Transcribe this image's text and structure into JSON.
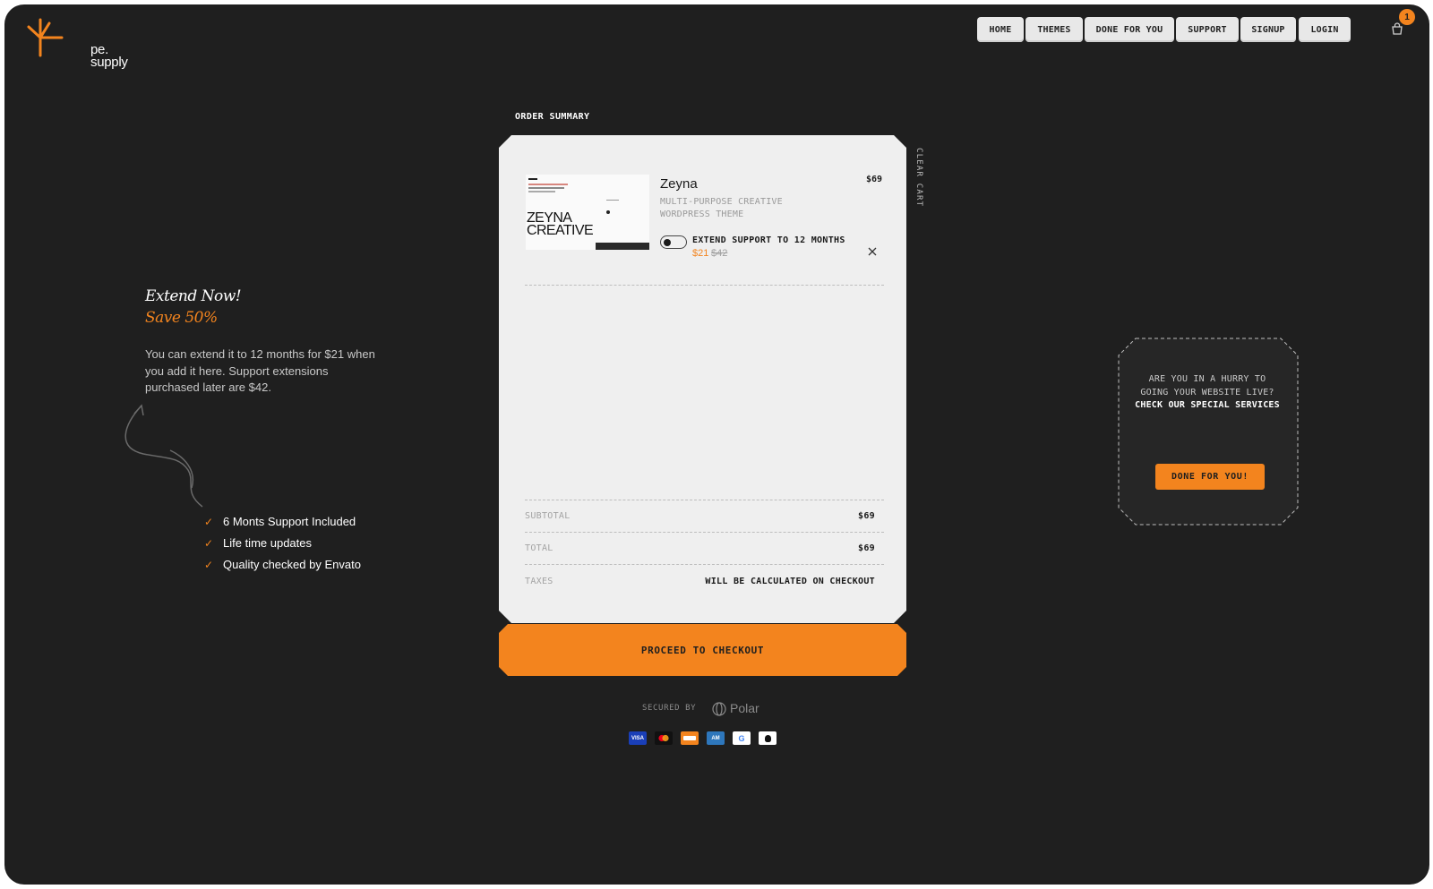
{
  "brand": {
    "logo_line1": "pe.",
    "logo_line2": "supply",
    "accent_color": "#f3841e"
  },
  "nav": {
    "items": [
      "HOME",
      "THEMES",
      "DONE FOR YOU",
      "SUPPORT",
      "SIGNUP",
      "LOGIN"
    ],
    "cart_count": "1",
    "cart_icon": "shopping-bag-icon"
  },
  "promo": {
    "title": "Extend Now!",
    "subtitle": "Save 50%",
    "text": "You can extend it to 12 months for $21 when you add it here. Support extensions purchased later are $42.",
    "features": [
      "6 Monts Support Included",
      "Life time updates",
      "Quality checked by Envato"
    ]
  },
  "order": {
    "label": "ORDER SUMMARY",
    "clear_cart": "CLEAR CART",
    "item": {
      "thumb_title_1": "ZEYNA",
      "thumb_title_2": "CREATIVE",
      "name": "Zeyna",
      "price": "$69",
      "description": "MULTI-PURPOSE CREATIVE WORDPRESS THEME",
      "extend_label": "EXTEND SUPPORT TO 12 MONTHS",
      "extend_price": "$21",
      "extend_old_price": "$42"
    },
    "subtotal_label": "SUBTOTAL",
    "subtotal_value": "$69",
    "total_label": "TOTAL",
    "total_value": "$69",
    "taxes_label": "TAXES",
    "taxes_value": "WILL BE CALCULATED ON CHECKOUT",
    "checkout_label": "PROCEED TO CHECKOUT"
  },
  "security": {
    "secured_by": "SECURED BY",
    "provider": "Polar"
  },
  "payment_methods": [
    "VISA",
    "Mastercard",
    "Discover",
    "American Express",
    "Google Pay",
    "Apple Pay"
  ],
  "services": {
    "question": "ARE YOU IN A HURRY TO GOING YOUR WEBSITE LIVE?",
    "highlight": "CHECK OUR SPECIAL SERVICES",
    "button": "DONE FOR YOU!"
  }
}
